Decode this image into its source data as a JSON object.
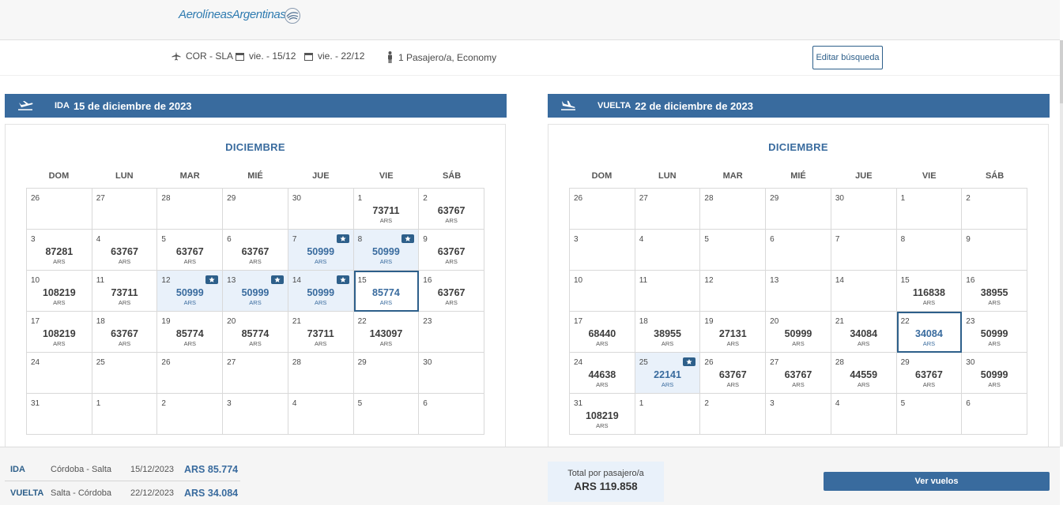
{
  "header": {
    "logo_text": "AerolíneasArgentinas"
  },
  "search": {
    "route": "COR - SLA",
    "depart_date": "vie. - 15/12",
    "return_date": "vie. - 22/12",
    "passengers": "1 Pasajero/a, Economy",
    "edit_label": "Editar búsqueda"
  },
  "colors": {
    "primary": "#396b9e",
    "promo_bg": "#e9f1fa",
    "selected_border": "#2d5f8a"
  },
  "days_of_week": [
    "DOM",
    "LUN",
    "MAR",
    "MIÉ",
    "JUE",
    "VIE",
    "SÁB"
  ],
  "outbound": {
    "type": "IDA",
    "date_title": "15 de diciembre de 2023",
    "month": "DICIEMBRE",
    "cells": [
      {
        "day": "26",
        "price": "",
        "cur": "",
        "promo": false,
        "selected": false
      },
      {
        "day": "27",
        "price": "",
        "cur": "",
        "promo": false,
        "selected": false
      },
      {
        "day": "28",
        "price": "",
        "cur": "",
        "promo": false,
        "selected": false
      },
      {
        "day": "29",
        "price": "",
        "cur": "",
        "promo": false,
        "selected": false
      },
      {
        "day": "30",
        "price": "",
        "cur": "",
        "promo": false,
        "selected": false
      },
      {
        "day": "1",
        "price": "73711",
        "cur": "ARS",
        "promo": false,
        "selected": false
      },
      {
        "day": "2",
        "price": "63767",
        "cur": "ARS",
        "promo": false,
        "selected": false
      },
      {
        "day": "3",
        "price": "87281",
        "cur": "ARS",
        "promo": false,
        "selected": false
      },
      {
        "day": "4",
        "price": "63767",
        "cur": "ARS",
        "promo": false,
        "selected": false
      },
      {
        "day": "5",
        "price": "63767",
        "cur": "ARS",
        "promo": false,
        "selected": false
      },
      {
        "day": "6",
        "price": "63767",
        "cur": "ARS",
        "promo": false,
        "selected": false
      },
      {
        "day": "7",
        "price": "50999",
        "cur": "ARS",
        "promo": true,
        "selected": false
      },
      {
        "day": "8",
        "price": "50999",
        "cur": "ARS",
        "promo": true,
        "selected": false
      },
      {
        "day": "9",
        "price": "63767",
        "cur": "ARS",
        "promo": false,
        "selected": false
      },
      {
        "day": "10",
        "price": "108219",
        "cur": "ARS",
        "promo": false,
        "selected": false
      },
      {
        "day": "11",
        "price": "73711",
        "cur": "ARS",
        "promo": false,
        "selected": false
      },
      {
        "day": "12",
        "price": "50999",
        "cur": "ARS",
        "promo": true,
        "selected": false
      },
      {
        "day": "13",
        "price": "50999",
        "cur": "ARS",
        "promo": true,
        "selected": false
      },
      {
        "day": "14",
        "price": "50999",
        "cur": "ARS",
        "promo": true,
        "selected": false
      },
      {
        "day": "15",
        "price": "85774",
        "cur": "ARS",
        "promo": false,
        "selected": true
      },
      {
        "day": "16",
        "price": "63767",
        "cur": "ARS",
        "promo": false,
        "selected": false
      },
      {
        "day": "17",
        "price": "108219",
        "cur": "ARS",
        "promo": false,
        "selected": false
      },
      {
        "day": "18",
        "price": "63767",
        "cur": "ARS",
        "promo": false,
        "selected": false
      },
      {
        "day": "19",
        "price": "85774",
        "cur": "ARS",
        "promo": false,
        "selected": false
      },
      {
        "day": "20",
        "price": "85774",
        "cur": "ARS",
        "promo": false,
        "selected": false
      },
      {
        "day": "21",
        "price": "73711",
        "cur": "ARS",
        "promo": false,
        "selected": false
      },
      {
        "day": "22",
        "price": "143097",
        "cur": "ARS",
        "promo": false,
        "selected": false
      },
      {
        "day": "23",
        "price": "",
        "cur": "",
        "promo": false,
        "selected": false
      },
      {
        "day": "24",
        "price": "",
        "cur": "",
        "promo": false,
        "selected": false
      },
      {
        "day": "25",
        "price": "",
        "cur": "",
        "promo": false,
        "selected": false
      },
      {
        "day": "26",
        "price": "",
        "cur": "",
        "promo": false,
        "selected": false
      },
      {
        "day": "27",
        "price": "",
        "cur": "",
        "promo": false,
        "selected": false
      },
      {
        "day": "28",
        "price": "",
        "cur": "",
        "promo": false,
        "selected": false
      },
      {
        "day": "29",
        "price": "",
        "cur": "",
        "promo": false,
        "selected": false
      },
      {
        "day": "30",
        "price": "",
        "cur": "",
        "promo": false,
        "selected": false
      },
      {
        "day": "31",
        "price": "",
        "cur": "",
        "promo": false,
        "selected": false
      },
      {
        "day": "1",
        "price": "",
        "cur": "",
        "promo": false,
        "selected": false
      },
      {
        "day": "2",
        "price": "",
        "cur": "",
        "promo": false,
        "selected": false
      },
      {
        "day": "3",
        "price": "",
        "cur": "",
        "promo": false,
        "selected": false
      },
      {
        "day": "4",
        "price": "",
        "cur": "",
        "promo": false,
        "selected": false
      },
      {
        "day": "5",
        "price": "",
        "cur": "",
        "promo": false,
        "selected": false
      },
      {
        "day": "6",
        "price": "",
        "cur": "",
        "promo": false,
        "selected": false
      }
    ]
  },
  "return": {
    "type": "VUELTA",
    "date_title": "22 de diciembre de 2023",
    "month": "DICIEMBRE",
    "cells": [
      {
        "day": "26",
        "price": "",
        "cur": "",
        "promo": false,
        "selected": false
      },
      {
        "day": "27",
        "price": "",
        "cur": "",
        "promo": false,
        "selected": false
      },
      {
        "day": "28",
        "price": "",
        "cur": "",
        "promo": false,
        "selected": false
      },
      {
        "day": "29",
        "price": "",
        "cur": "",
        "promo": false,
        "selected": false
      },
      {
        "day": "30",
        "price": "",
        "cur": "",
        "promo": false,
        "selected": false
      },
      {
        "day": "1",
        "price": "",
        "cur": "",
        "promo": false,
        "selected": false
      },
      {
        "day": "2",
        "price": "",
        "cur": "",
        "promo": false,
        "selected": false
      },
      {
        "day": "3",
        "price": "",
        "cur": "",
        "promo": false,
        "selected": false
      },
      {
        "day": "4",
        "price": "",
        "cur": "",
        "promo": false,
        "selected": false
      },
      {
        "day": "5",
        "price": "",
        "cur": "",
        "promo": false,
        "selected": false
      },
      {
        "day": "6",
        "price": "",
        "cur": "",
        "promo": false,
        "selected": false
      },
      {
        "day": "7",
        "price": "",
        "cur": "",
        "promo": false,
        "selected": false
      },
      {
        "day": "8",
        "price": "",
        "cur": "",
        "promo": false,
        "selected": false
      },
      {
        "day": "9",
        "price": "",
        "cur": "",
        "promo": false,
        "selected": false
      },
      {
        "day": "10",
        "price": "",
        "cur": "",
        "promo": false,
        "selected": false
      },
      {
        "day": "11",
        "price": "",
        "cur": "",
        "promo": false,
        "selected": false
      },
      {
        "day": "12",
        "price": "",
        "cur": "",
        "promo": false,
        "selected": false
      },
      {
        "day": "13",
        "price": "",
        "cur": "",
        "promo": false,
        "selected": false
      },
      {
        "day": "14",
        "price": "",
        "cur": "",
        "promo": false,
        "selected": false
      },
      {
        "day": "15",
        "price": "116838",
        "cur": "ARS",
        "promo": false,
        "selected": false
      },
      {
        "day": "16",
        "price": "38955",
        "cur": "ARS",
        "promo": false,
        "selected": false
      },
      {
        "day": "17",
        "price": "68440",
        "cur": "ARS",
        "promo": false,
        "selected": false
      },
      {
        "day": "18",
        "price": "38955",
        "cur": "ARS",
        "promo": false,
        "selected": false
      },
      {
        "day": "19",
        "price": "27131",
        "cur": "ARS",
        "promo": false,
        "selected": false
      },
      {
        "day": "20",
        "price": "50999",
        "cur": "ARS",
        "promo": false,
        "selected": false
      },
      {
        "day": "21",
        "price": "34084",
        "cur": "ARS",
        "promo": false,
        "selected": false
      },
      {
        "day": "22",
        "price": "34084",
        "cur": "ARS",
        "promo": false,
        "selected": true
      },
      {
        "day": "23",
        "price": "50999",
        "cur": "ARS",
        "promo": false,
        "selected": false
      },
      {
        "day": "24",
        "price": "44638",
        "cur": "ARS",
        "promo": false,
        "selected": false
      },
      {
        "day": "25",
        "price": "22141",
        "cur": "ARS",
        "promo": true,
        "selected": false
      },
      {
        "day": "26",
        "price": "63767",
        "cur": "ARS",
        "promo": false,
        "selected": false
      },
      {
        "day": "27",
        "price": "63767",
        "cur": "ARS",
        "promo": false,
        "selected": false
      },
      {
        "day": "28",
        "price": "44559",
        "cur": "ARS",
        "promo": false,
        "selected": false
      },
      {
        "day": "29",
        "price": "63767",
        "cur": "ARS",
        "promo": false,
        "selected": false
      },
      {
        "day": "30",
        "price": "50999",
        "cur": "ARS",
        "promo": false,
        "selected": false
      },
      {
        "day": "31",
        "price": "108219",
        "cur": "ARS",
        "promo": false,
        "selected": false
      },
      {
        "day": "1",
        "price": "",
        "cur": "",
        "promo": false,
        "selected": false
      },
      {
        "day": "2",
        "price": "",
        "cur": "",
        "promo": false,
        "selected": false
      },
      {
        "day": "3",
        "price": "",
        "cur": "",
        "promo": false,
        "selected": false
      },
      {
        "day": "4",
        "price": "",
        "cur": "",
        "promo": false,
        "selected": false
      },
      {
        "day": "5",
        "price": "",
        "cur": "",
        "promo": false,
        "selected": false
      },
      {
        "day": "6",
        "price": "",
        "cur": "",
        "promo": false,
        "selected": false
      }
    ]
  },
  "summary": {
    "outbound": {
      "type": "IDA",
      "route": "Córdoba - Salta",
      "date": "15/12/2023",
      "price": "ARS 85.774"
    },
    "return": {
      "type": "VUELTA",
      "route": "Salta - Córdoba",
      "date": "22/12/2023",
      "price": "ARS 34.084"
    },
    "total_label": "Total por pasajero/a",
    "total_value": "ARS 119.858",
    "cta_label": "Ver vuelos"
  }
}
